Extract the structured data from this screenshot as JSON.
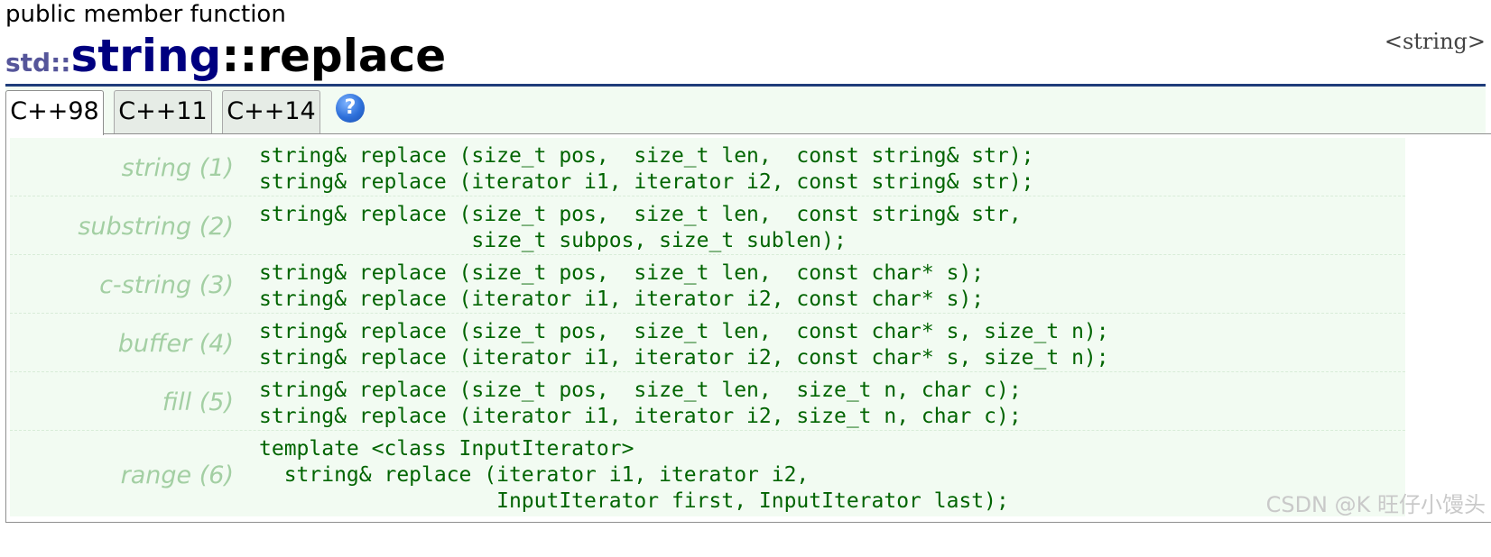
{
  "page": {
    "kind": "public member function",
    "title_ns": "std::",
    "title_class": "string",
    "title_sep": "::",
    "title_member": "replace",
    "header": "<string>"
  },
  "tabs": [
    {
      "label": "C++98",
      "active": true
    },
    {
      "label": "C++11",
      "active": false
    },
    {
      "label": "C++14",
      "active": false
    }
  ],
  "help_icon": {
    "name": "help-icon",
    "glyph": "?"
  },
  "overloads": [
    {
      "label": "string (1)",
      "lines": [
        "string& replace (size_t pos,  size_t len,  const string& str);",
        "string& replace (iterator i1, iterator i2, const string& str);"
      ]
    },
    {
      "label": "substring (2)",
      "lines": [
        "string& replace (size_t pos,  size_t len,  const string& str,",
        "                 size_t subpos, size_t sublen);"
      ]
    },
    {
      "label": "c-string (3)",
      "lines": [
        "string& replace (size_t pos,  size_t len,  const char* s);",
        "string& replace (iterator i1, iterator i2, const char* s);"
      ]
    },
    {
      "label": "buffer (4)",
      "lines": [
        "string& replace (size_t pos,  size_t len,  const char* s, size_t n);",
        "string& replace (iterator i1, iterator i2, const char* s, size_t n);"
      ]
    },
    {
      "label": "fill (5)",
      "lines": [
        "string& replace (size_t pos,  size_t len,  size_t n, char c);",
        "string& replace (iterator i1, iterator i2, size_t n, char c);"
      ]
    },
    {
      "label": "range (6)",
      "lines": [
        "template <class InputIterator>",
        "  string& replace (iterator i1, iterator i2,",
        "                   InputIterator first, InputIterator last);"
      ]
    }
  ],
  "watermark": "CSDN @K 旺仔小馒头",
  "colors": {
    "title_class": "#000080",
    "namespace": "#55559a",
    "code": "#006400",
    "label": "#a3cfa3",
    "row_bg": "#f2fbf2",
    "rule": "#1f3c7a"
  }
}
